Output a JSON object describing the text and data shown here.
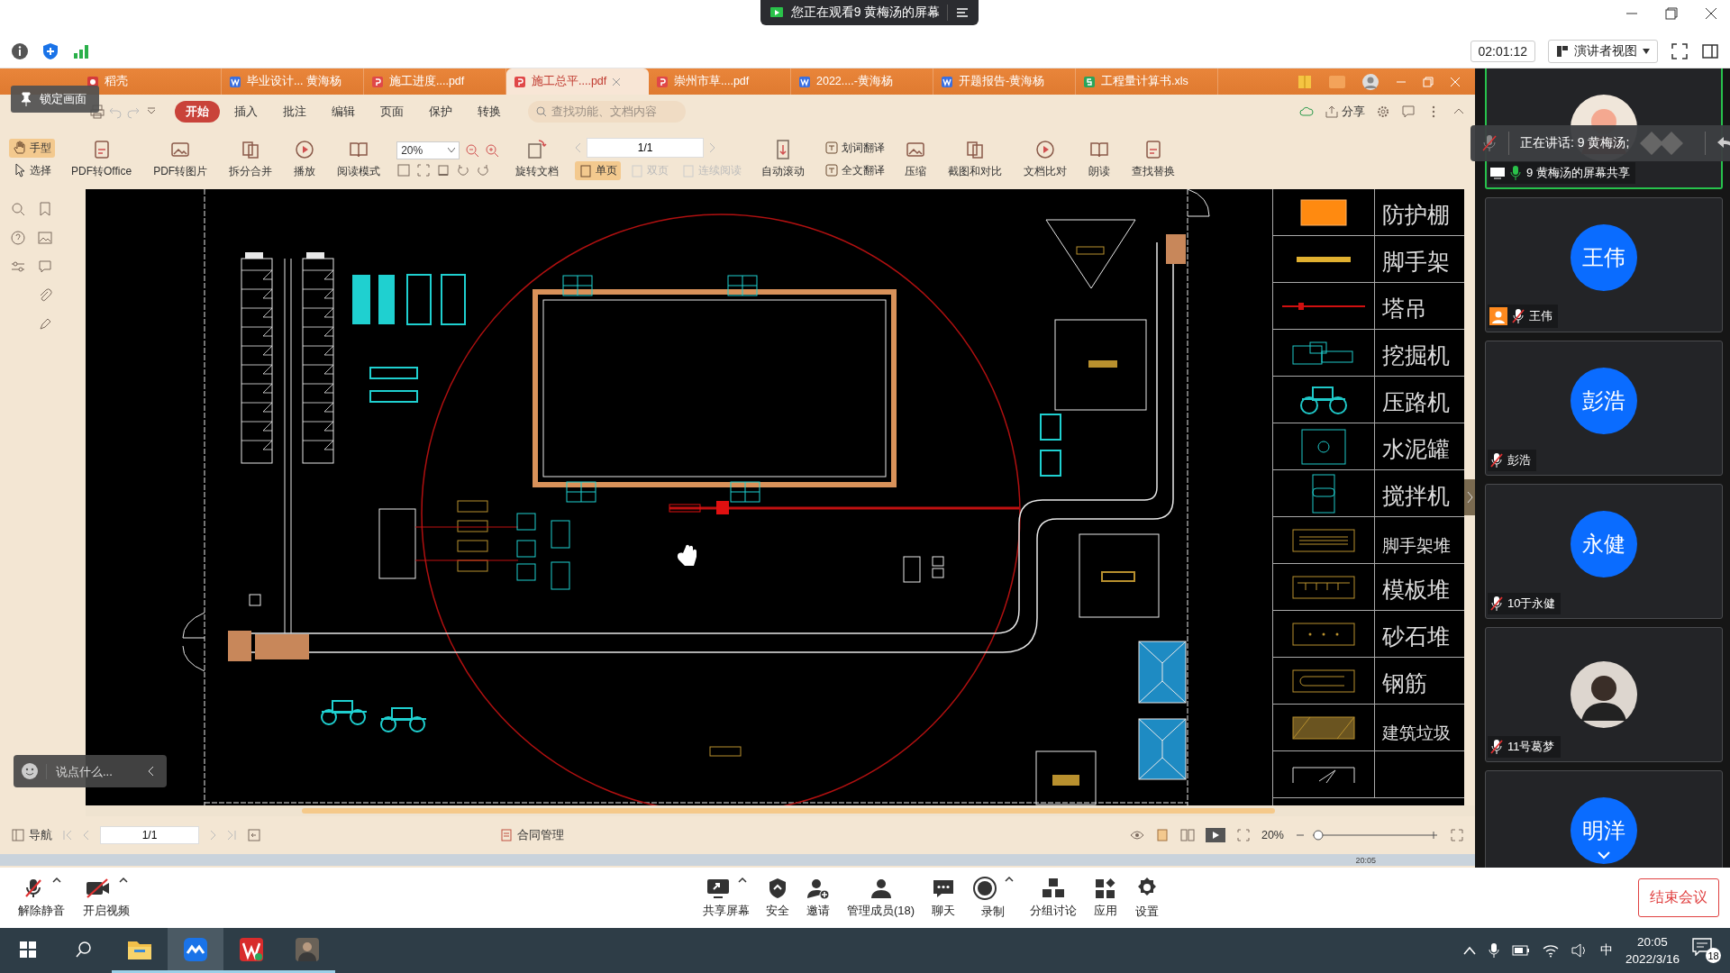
{
  "share_banner": {
    "text": "您正在观看9 黄梅汤的屏幕"
  },
  "top_toolbar": {
    "timer": "02:01:12",
    "view_mode": "演讲者视图"
  },
  "shared_screen": {
    "lock_badge": "锁定画面",
    "doc_tabs": [
      {
        "label": "稻壳",
        "kind": "home",
        "selected": false
      },
      {
        "label": "毕业设计... 黄海杨",
        "kind": "doc",
        "selected": false
      },
      {
        "label": "施工进度....pdf",
        "kind": "pdf",
        "selected": false
      },
      {
        "label": "施工总平....pdf",
        "kind": "pdf",
        "selected": true
      },
      {
        "label": "崇州市草....pdf",
        "kind": "pdf",
        "selected": false
      },
      {
        "label": "2022....-黄海杨",
        "kind": "doc",
        "selected": false
      },
      {
        "label": "开题报告-黄海杨",
        "kind": "doc",
        "selected": false
      },
      {
        "label": "工程量计算书.xls",
        "kind": "xls",
        "selected": false
      }
    ],
    "menu": [
      {
        "label": "开始",
        "selected": true
      },
      {
        "label": "插入",
        "selected": false
      },
      {
        "label": "批注",
        "selected": false
      },
      {
        "label": "编辑",
        "selected": false
      },
      {
        "label": "页面",
        "selected": false
      },
      {
        "label": "保护",
        "selected": false
      },
      {
        "label": "转换",
        "selected": false
      }
    ],
    "search": {
      "placeholder": "查找功能、文档内容"
    },
    "share_button": "分享",
    "toolbar": {
      "cursor_modes": [
        {
          "label": "手型",
          "selected": true
        },
        {
          "label": "选择",
          "selected": false
        }
      ],
      "convert_tools": [
        "PDF转Office",
        "PDF转图片",
        "拆分合并",
        "播放",
        "阅读模式"
      ],
      "zoom": "20%",
      "rotate": "旋转文档",
      "page": "1/1",
      "page_modes": [
        {
          "label": "单页",
          "selected": true,
          "disabled": false
        },
        {
          "label": "双页",
          "selected": false,
          "disabled": true
        },
        {
          "label": "连续阅读",
          "selected": false,
          "disabled": true
        }
      ],
      "auto_scroll": "自动滚动",
      "translate": [
        "划词翻译",
        "全文翻译"
      ],
      "tools": [
        "压缩",
        "截图和对比",
        "文档比对",
        "朗读",
        "查找替换"
      ]
    },
    "legend": [
      {
        "label": "防护棚",
        "kind": "shed"
      },
      {
        "label": "脚手架",
        "kind": "scaffold"
      },
      {
        "label": "塔吊",
        "kind": "crane"
      },
      {
        "label": "挖掘机",
        "kind": "excavator"
      },
      {
        "label": "压路机",
        "kind": "roller"
      },
      {
        "label": "水泥罐",
        "kind": "tank"
      },
      {
        "label": "搅拌机",
        "kind": "mixer"
      },
      {
        "label": "脚手架堆",
        "kind": "scaffold-pile"
      },
      {
        "label": "模板堆",
        "kind": "formwork-pile"
      },
      {
        "label": "砂石堆",
        "kind": "sand-pile"
      },
      {
        "label": "钢筋",
        "kind": "rebar"
      },
      {
        "label": "建筑垃圾",
        "kind": "waste"
      },
      {
        "kind": "arrow"
      }
    ],
    "chat": {
      "placeholder": "说点什么..."
    },
    "status_bar": {
      "nav": "导航",
      "page": "1/1",
      "contract": "合同管理",
      "zoom": "20%"
    },
    "remote_clock": "20:05"
  },
  "speaking_toast": "正在讲话: 9 黄梅汤;",
  "participants": [
    {
      "name": "9 黄梅汤的屏幕共享",
      "kind": "picture",
      "speaking": true,
      "muted": false,
      "sharing": true,
      "host": false
    },
    {
      "avatar": "王伟",
      "name": "王伟",
      "kind": "initials",
      "speaking": false,
      "muted": true,
      "sharing": false,
      "host": true
    },
    {
      "avatar": "彭浩",
      "name": "彭浩",
      "kind": "initials",
      "speaking": false,
      "muted": true,
      "sharing": false,
      "host": false
    },
    {
      "avatar": "永健",
      "name": "10于永健",
      "kind": "initials",
      "speaking": false,
      "muted": true,
      "sharing": false,
      "host": false
    },
    {
      "name": "11号葛梦",
      "kind": "picture",
      "speaking": false,
      "muted": true,
      "sharing": false,
      "host": false
    },
    {
      "avatar": "明洋",
      "kind": "initials",
      "speaking": false
    }
  ],
  "meeting_controls": {
    "left": [
      {
        "label": "解除静音",
        "kind": "mic-off",
        "menu": true
      },
      {
        "label": "开启视频",
        "kind": "camera-off",
        "menu": true
      }
    ],
    "center": [
      {
        "label": "共享屏幕",
        "kind": "share",
        "menu": true
      },
      {
        "label": "安全",
        "kind": "shield",
        "menu": false
      },
      {
        "label": "邀请",
        "kind": "invite",
        "menu": false
      },
      {
        "label": "管理成员(18)",
        "kind": "members",
        "menu": false
      },
      {
        "label": "聊天",
        "kind": "chat",
        "menu": false
      },
      {
        "label": "录制",
        "kind": "record",
        "menu": true
      },
      {
        "label": "分组讨论",
        "kind": "breakout",
        "menu": false
      },
      {
        "label": "应用",
        "kind": "apps",
        "menu": false
      },
      {
        "label": "设置",
        "kind": "settings",
        "menu": false
      }
    ]
  },
  "end_button": "结束会议",
  "taskbar": {
    "apps": [
      {
        "kind": "explorer",
        "selected": false,
        "running": true
      },
      {
        "kind": "meeting",
        "selected": true,
        "running": true
      },
      {
        "kind": "wps",
        "selected": false,
        "running": true
      },
      {
        "kind": "photo",
        "selected": false,
        "running": true
      }
    ],
    "ime": "中",
    "time": "20:05",
    "date": "2022/3/16",
    "notifications": "18"
  }
}
